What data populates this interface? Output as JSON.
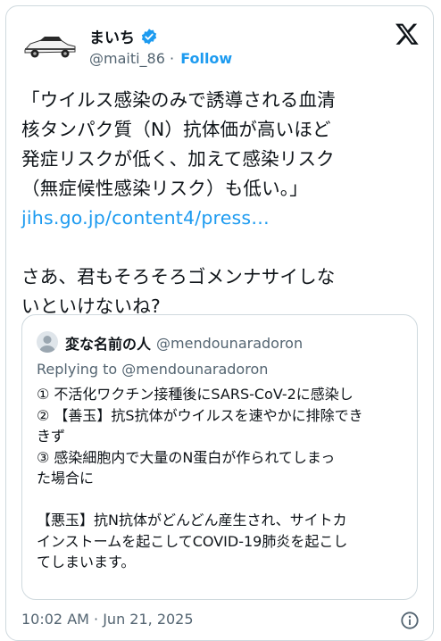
{
  "author": {
    "display_name": "まいち",
    "handle": "@maiti_86",
    "separator": " · ",
    "follow_label": "Follow"
  },
  "tweet": {
    "lines": [
      "「ウイルス感染のみで誘導される血清",
      "核タンパク質（N）抗体価が高いほど",
      "発症リスクが低く、加えて感染リスク",
      "（無症候性感染リスク）も低い。」"
    ],
    "link": "jihs.go.jp/content4/press…",
    "lines2": [
      "さあ、君もそろそろゴメンナサイしな",
      "いといけないね?"
    ]
  },
  "quote": {
    "display_name": "変な名前の人",
    "handle": "@mendounaradoron",
    "replying": "Replying to @mendounaradoron",
    "lines": [
      "① 不活化ワクチン接種後にSARS-CoV-2に感染し",
      "② 【善玉】抗S抗体がウイルスを速やかに排除でき",
      "きず",
      "③ 感染細胞内で大量のN蛋白が作られてしまっ",
      "た場合に"
    ],
    "lines2": [
      "【悪玉】抗N抗体がどんどん産生され、サイトカ",
      "インストームを起こしてCOVID-19肺炎を起こし",
      "てしまいます。"
    ]
  },
  "footer": {
    "timestamp": "10:02 AM · Jun 21, 2025"
  },
  "icons": {
    "verified": "verified-badge-icon",
    "x_logo": "x-logo-icon",
    "info": "info-icon"
  },
  "colors": {
    "link": "#1d9bf0",
    "secondary_text": "#536471",
    "border": "#cfd9de"
  }
}
